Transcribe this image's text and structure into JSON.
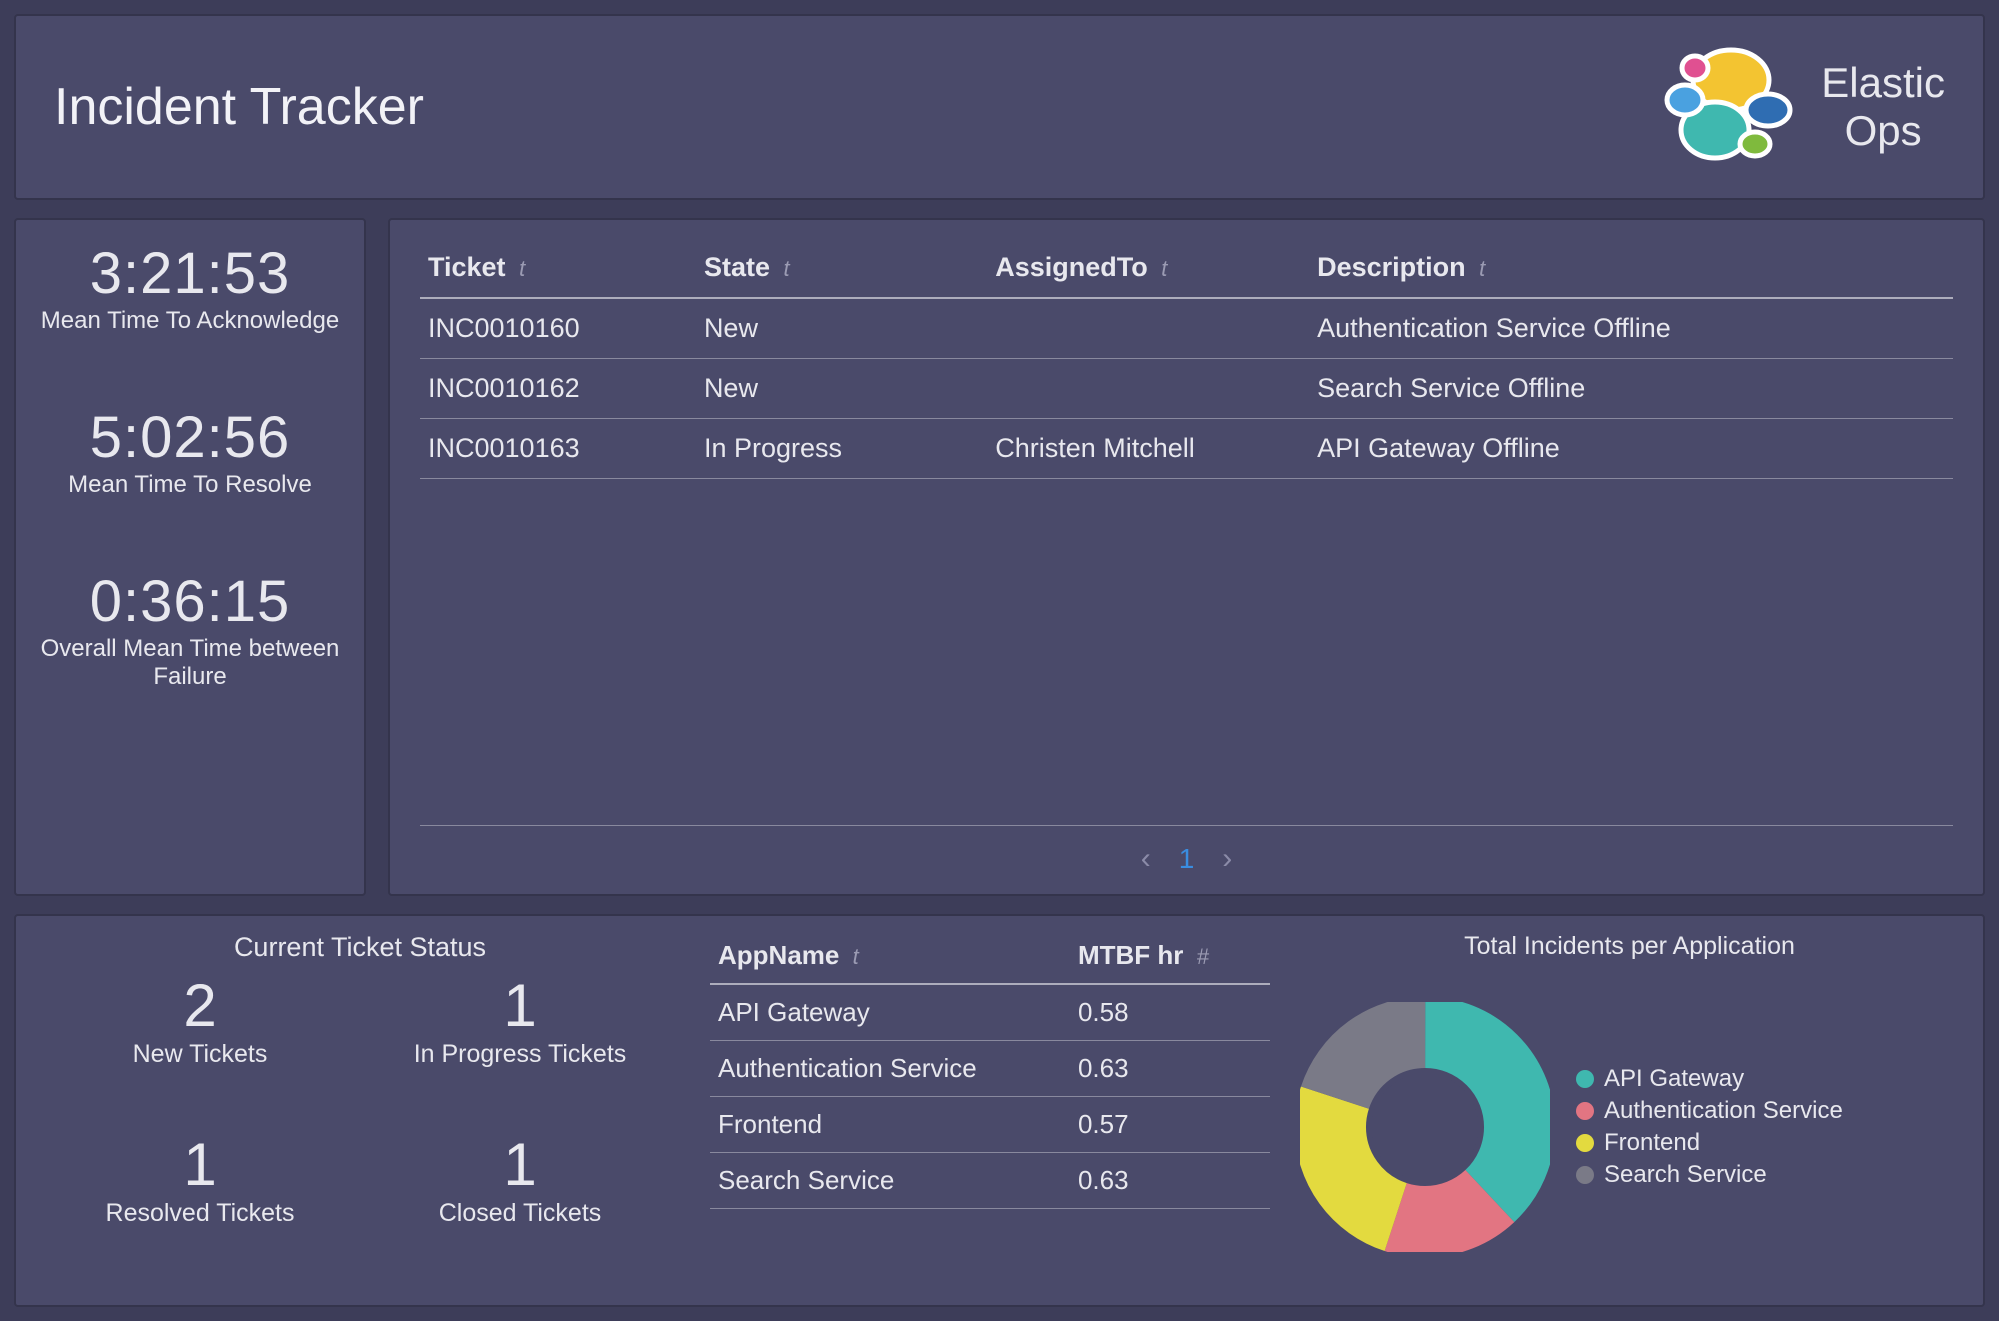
{
  "header": {
    "title": "Incident Tracker",
    "brand_line1": "Elastic",
    "brand_line2": "Ops"
  },
  "metrics": [
    {
      "value": "3:21:53",
      "label": "Mean Time To Acknowledge"
    },
    {
      "value": "5:02:56",
      "label": "Mean Time To Resolve"
    },
    {
      "value": "0:36:15",
      "label": "Overall Mean Time between Failure"
    }
  ],
  "ticket_table": {
    "columns": [
      "Ticket",
      "State",
      "AssignedTo",
      "Description"
    ],
    "col_icon_glyph": "t",
    "rows": [
      {
        "ticket": "INC0010160",
        "state": "New",
        "assigned": "",
        "desc": "Authentication Service Offline"
      },
      {
        "ticket": "INC0010162",
        "state": "New",
        "assigned": "",
        "desc": "Search Service Offline"
      },
      {
        "ticket": "INC0010163",
        "state": "In Progress",
        "assigned": "Christen Mitchell",
        "desc": "API Gateway Offline"
      }
    ],
    "pager": {
      "current": "1"
    }
  },
  "status": {
    "title": "Current Ticket Status",
    "cells": [
      {
        "count": "2",
        "label": "New Tickets"
      },
      {
        "count": "1",
        "label": "In Progress Tickets"
      },
      {
        "count": "1",
        "label": "Resolved Tickets"
      },
      {
        "count": "1",
        "label": "Closed Tickets"
      }
    ]
  },
  "mtbf_table": {
    "col1": "AppName",
    "col2": "MTBF hr",
    "col1_icon": "t",
    "col2_icon": "#",
    "rows": [
      {
        "app": "API Gateway",
        "mtbf": "0.58"
      },
      {
        "app": "Authentication Service",
        "mtbf": "0.63"
      },
      {
        "app": "Frontend",
        "mtbf": "0.57"
      },
      {
        "app": "Search Service",
        "mtbf": "0.63"
      }
    ]
  },
  "donut": {
    "title": "Total Incidents per Application",
    "legend": [
      {
        "label": "API Gateway",
        "color": "#3fb8af"
      },
      {
        "label": "Authentication Service",
        "color": "#e27582"
      },
      {
        "label": "Frontend",
        "color": "#e3da3f"
      },
      {
        "label": "Search Service",
        "color": "#7a7a87"
      }
    ]
  },
  "chart_data": {
    "type": "pie",
    "title": "Total Incidents per Application",
    "series": [
      {
        "name": "API Gateway",
        "value": 38,
        "color": "#3fb8af"
      },
      {
        "name": "Authentication Service",
        "value": 17,
        "color": "#e27582"
      },
      {
        "name": "Frontend",
        "value": 25,
        "color": "#e3da3f"
      },
      {
        "name": "Search Service",
        "value": 20,
        "color": "#7a7a87"
      }
    ],
    "note": "Slice percentages estimated from visual arc lengths; exact counts not labeled on chart."
  },
  "logo_colors": {
    "yellow": "#f3c431",
    "teal": "#3fb8af",
    "blue_d": "#2f6db2",
    "blue_l": "#4aa1e0",
    "pink": "#e05091",
    "green": "#7fba3d"
  }
}
